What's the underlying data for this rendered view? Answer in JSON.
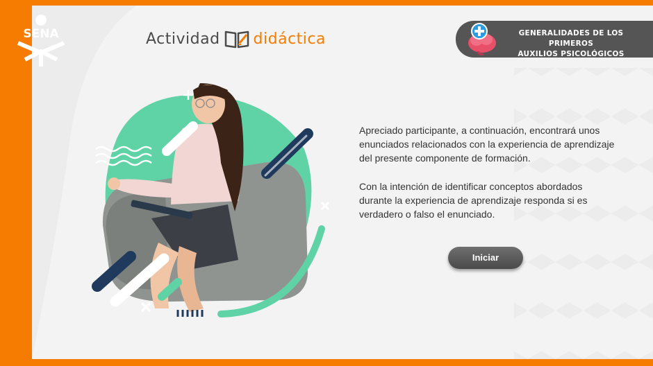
{
  "brand": {
    "logo_text": "SENA",
    "accent_color": "#f57c00",
    "frame_color": "#f57c00"
  },
  "header": {
    "title_part1": "Actividad",
    "title_part2": "didáctica",
    "title_icon": "book-pencil-icon"
  },
  "topic": {
    "line1": "GENERALIDADES DE LOS PRIMEROS",
    "line2": "AUXILIOS PSICOLÓGICOS",
    "icon": "brain-plus-icon"
  },
  "intro": {
    "paragraph1": "Apreciado participante, a continuación, encontrará unos enunciados relacionados con la experiencia de aprendizaje del presente componente de formación.",
    "paragraph2": "Con la intención de identificar conceptos abordados durante la experiencia de aprendizaje responda si es verdadero o falso el enunciado."
  },
  "actions": {
    "start_label": "Iniciar"
  },
  "colors": {
    "mint": "#5fd3a6",
    "navy": "#1f3a5c",
    "badge_gray": "#555555",
    "button_gray": "#555555"
  }
}
